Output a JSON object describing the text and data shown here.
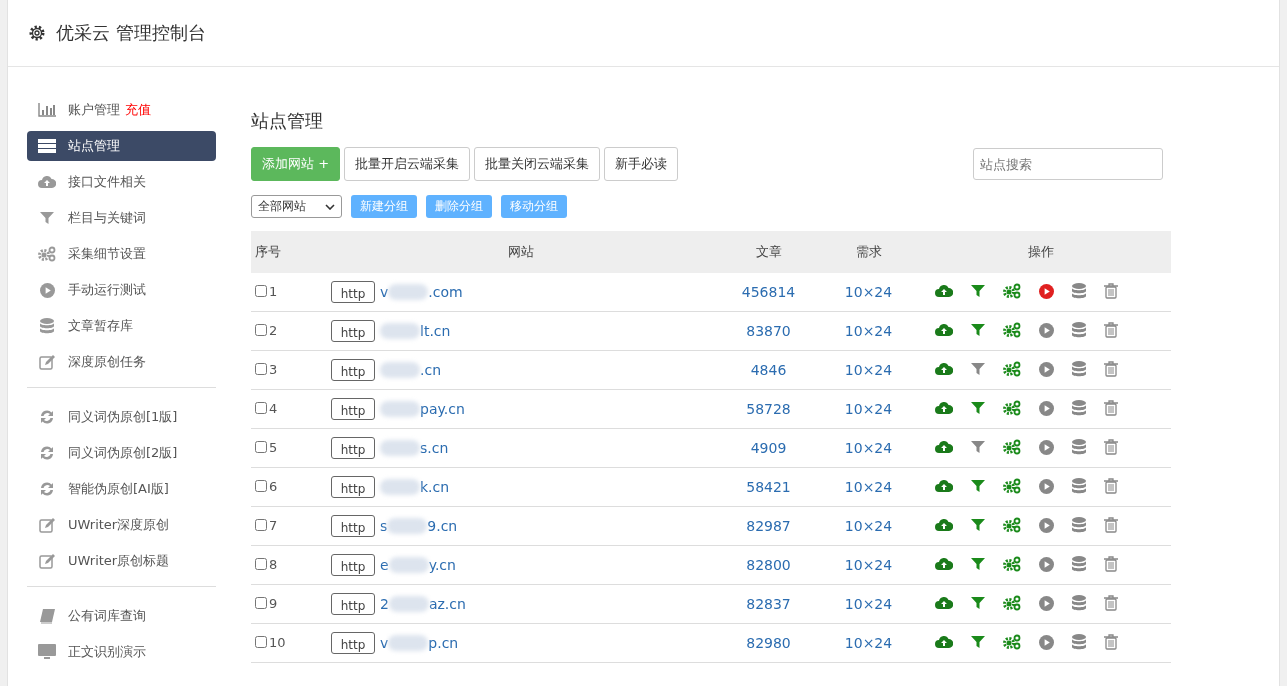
{
  "header": {
    "title": "优采云 管理控制台"
  },
  "sidebar": {
    "groups": [
      {
        "items": [
          {
            "label": "账户管理",
            "badge": "充值",
            "selected": false
          },
          {
            "label": "站点管理",
            "selected": true
          },
          {
            "label": "接口文件相关",
            "selected": false
          },
          {
            "label": "栏目与关键词",
            "selected": false
          },
          {
            "label": "采集细节设置",
            "selected": false
          },
          {
            "label": "手动运行测试",
            "selected": false
          },
          {
            "label": "文章暂存库",
            "selected": false
          },
          {
            "label": "深度原创任务",
            "selected": false
          }
        ]
      },
      {
        "items": [
          {
            "label": "同义词伪原创[1版]",
            "selected": false
          },
          {
            "label": "同义词伪原创[2版]",
            "selected": false
          },
          {
            "label": "智能伪原创[AI版]",
            "selected": false
          },
          {
            "label": "UWriter深度原创",
            "selected": false
          },
          {
            "label": "UWriter原创标题",
            "selected": false
          }
        ]
      },
      {
        "items": [
          {
            "label": "公有词库查询",
            "selected": false
          },
          {
            "label": "正文识别演示",
            "selected": false
          }
        ]
      }
    ]
  },
  "main": {
    "title": "站点管理",
    "add_button": "添加网站 +",
    "buttons": [
      "批量开启云端采集",
      "批量关闭云端采集",
      "新手必读"
    ],
    "search": {
      "placeholder": "站点搜索"
    },
    "group_select": "全部网站",
    "group_buttons": [
      "新建分组",
      "删除分组",
      "移动分组"
    ],
    "table": {
      "columns": [
        "序号",
        "网站",
        "文章",
        "需求",
        "操作"
      ],
      "rows": [
        {
          "checked": false,
          "index": "1",
          "protocol": "http",
          "site_start": "v",
          "site_end": ".com",
          "articles": "456814",
          "demand": "10×24",
          "filter_on": true,
          "running": true
        },
        {
          "checked": false,
          "index": "2",
          "protocol": "http",
          "site_start": "",
          "site_end": "lt.cn",
          "articles": "83870",
          "demand": "10×24",
          "filter_on": true,
          "running": false
        },
        {
          "checked": false,
          "index": "3",
          "protocol": "http",
          "site_start": "",
          "site_end": ".cn",
          "articles": "4846",
          "demand": "10×24",
          "filter_on": false,
          "running": false
        },
        {
          "checked": false,
          "index": "4",
          "protocol": "http",
          "site_start": "",
          "site_end": "pay.cn",
          "articles": "58728",
          "demand": "10×24",
          "filter_on": true,
          "running": false
        },
        {
          "checked": false,
          "index": "5",
          "protocol": "http",
          "site_start": "",
          "site_end": "s.cn",
          "articles": "4909",
          "demand": "10×24",
          "filter_on": false,
          "running": false
        },
        {
          "checked": false,
          "index": "6",
          "protocol": "http",
          "site_start": "",
          "site_end": "k.cn",
          "articles": "58421",
          "demand": "10×24",
          "filter_on": true,
          "running": false
        },
        {
          "checked": false,
          "index": "7",
          "protocol": "http",
          "site_start": "s",
          "site_end": "9.cn",
          "articles": "82987",
          "demand": "10×24",
          "filter_on": true,
          "running": false
        },
        {
          "checked": false,
          "index": "8",
          "protocol": "http",
          "site_start": "e",
          "site_end": "y.cn",
          "articles": "82800",
          "demand": "10×24",
          "filter_on": true,
          "running": false
        },
        {
          "checked": false,
          "index": "9",
          "protocol": "http",
          "site_start": "2",
          "site_end": "az.cn",
          "articles": "82837",
          "demand": "10×24",
          "filter_on": true,
          "running": false
        },
        {
          "checked": false,
          "index": "10",
          "protocol": "http",
          "site_start": "v",
          "site_end": "p.cn",
          "articles": "82980",
          "demand": "10×24",
          "filter_on": true,
          "running": false
        }
      ]
    }
  }
}
